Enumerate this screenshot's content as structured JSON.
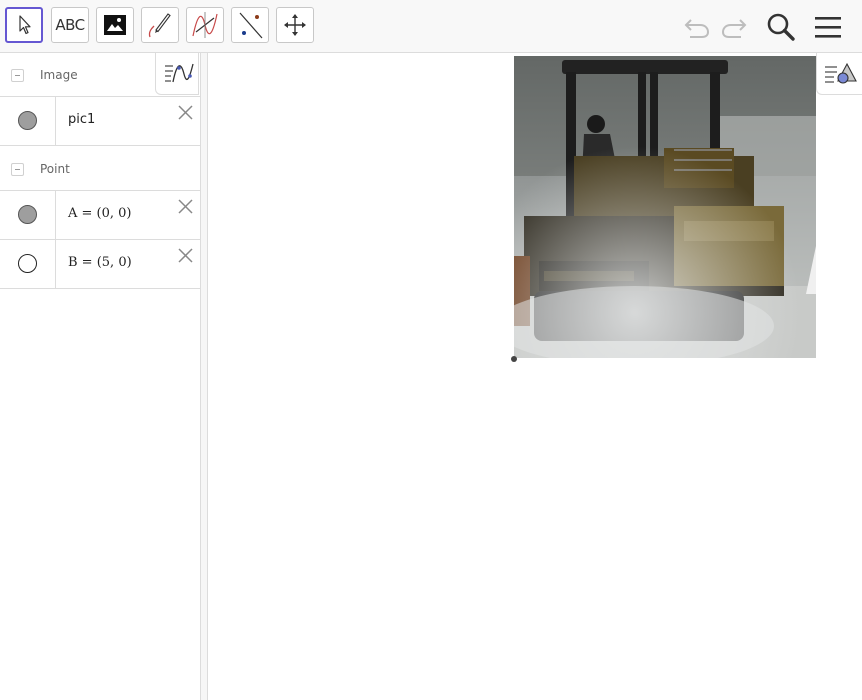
{
  "toolbar": {
    "tools": [
      {
        "name": "move-tool",
        "icon": "cursor-arrow-icon"
      },
      {
        "name": "text-tool",
        "label": "ABC"
      },
      {
        "name": "image-tool",
        "icon": "image-icon"
      },
      {
        "name": "pen-tool",
        "icon": "pen-icon"
      },
      {
        "name": "function-inspector-tool",
        "icon": "function-icon"
      },
      {
        "name": "point-on-line-tool",
        "icon": "point-line-icon"
      },
      {
        "name": "move-graphics-view-tool",
        "icon": "move-arrows-icon"
      }
    ],
    "right": [
      "undo-icon",
      "redo-icon",
      "search-icon",
      "menu-icon"
    ]
  },
  "algebra": {
    "groups": [
      {
        "label": "Image",
        "items": [
          {
            "text": "pic1",
            "visible": true
          }
        ]
      },
      {
        "label": "Point",
        "items": [
          {
            "text": "A = (0, 0)",
            "visible": true
          },
          {
            "text": "B = (5, 0)",
            "visible": false
          }
        ]
      }
    ]
  },
  "colors": {
    "accent": "#6557d2",
    "marble_on": "#9e9e9e"
  }
}
